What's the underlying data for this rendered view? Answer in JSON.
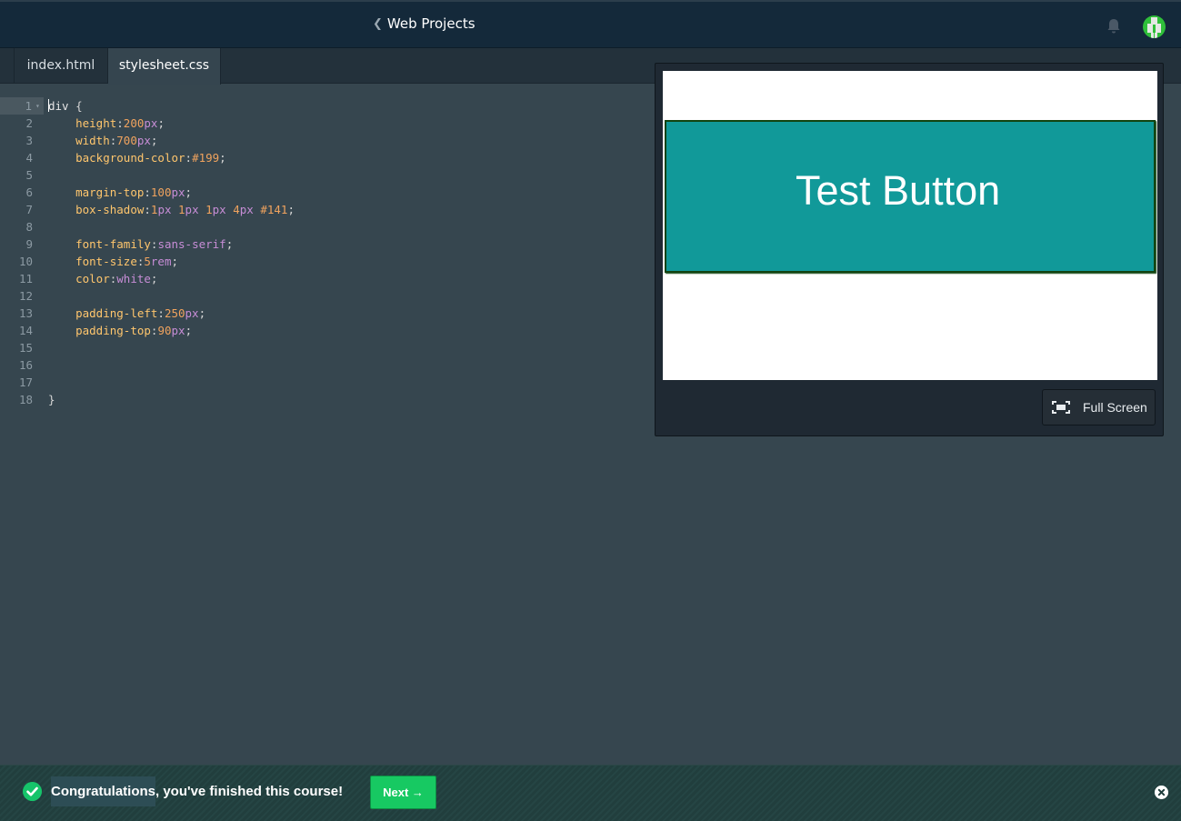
{
  "header": {
    "back_icon": "chevron-left-icon",
    "title": "Web Projects",
    "bell_icon": "bell-icon",
    "avatar_icon": "user-avatar-icon"
  },
  "tabs": [
    {
      "label": "index.html",
      "active": false
    },
    {
      "label": "stylesheet.css",
      "active": true
    }
  ],
  "editor": {
    "lines": [
      {
        "n": "1",
        "parts": [
          [
            "sel",
            "div"
          ],
          [
            "punc",
            " {"
          ]
        ]
      },
      {
        "n": "2",
        "parts": [
          [
            "punc",
            "    "
          ],
          [
            "prop",
            "height"
          ],
          [
            "punc",
            ":"
          ],
          [
            "num",
            "200"
          ],
          [
            "unit",
            "px"
          ],
          [
            "punc",
            ";"
          ]
        ]
      },
      {
        "n": "3",
        "parts": [
          [
            "punc",
            "    "
          ],
          [
            "prop",
            "width"
          ],
          [
            "punc",
            ":"
          ],
          [
            "num",
            "700"
          ],
          [
            "unit",
            "px"
          ],
          [
            "punc",
            ";"
          ]
        ]
      },
      {
        "n": "4",
        "parts": [
          [
            "punc",
            "    "
          ],
          [
            "prop",
            "background-color"
          ],
          [
            "punc",
            ":"
          ],
          [
            "num",
            "#199"
          ],
          [
            "punc",
            ";"
          ]
        ]
      },
      {
        "n": "5",
        "parts": []
      },
      {
        "n": "6",
        "parts": [
          [
            "punc",
            "    "
          ],
          [
            "prop",
            "margin-top"
          ],
          [
            "punc",
            ":"
          ],
          [
            "num",
            "100"
          ],
          [
            "unit",
            "px"
          ],
          [
            "punc",
            ";"
          ]
        ]
      },
      {
        "n": "7",
        "parts": [
          [
            "punc",
            "    "
          ],
          [
            "prop",
            "box-shadow"
          ],
          [
            "punc",
            ":"
          ],
          [
            "num",
            "1"
          ],
          [
            "unit",
            "px "
          ],
          [
            "num",
            "1"
          ],
          [
            "unit",
            "px "
          ],
          [
            "num",
            "1"
          ],
          [
            "unit",
            "px "
          ],
          [
            "num",
            "4"
          ],
          [
            "unit",
            "px "
          ],
          [
            "num",
            "#141"
          ],
          [
            "punc",
            ";"
          ]
        ]
      },
      {
        "n": "8",
        "parts": []
      },
      {
        "n": "9",
        "parts": [
          [
            "punc",
            "    "
          ],
          [
            "prop",
            "font-family"
          ],
          [
            "punc",
            ":"
          ],
          [
            "kw",
            "sans-serif"
          ],
          [
            "punc",
            ";"
          ]
        ]
      },
      {
        "n": "10",
        "parts": [
          [
            "punc",
            "    "
          ],
          [
            "prop",
            "font-size"
          ],
          [
            "punc",
            ":"
          ],
          [
            "num",
            "5"
          ],
          [
            "unit",
            "rem"
          ],
          [
            "punc",
            ";"
          ]
        ]
      },
      {
        "n": "11",
        "parts": [
          [
            "punc",
            "    "
          ],
          [
            "prop",
            "color"
          ],
          [
            "punc",
            ":"
          ],
          [
            "kw",
            "white"
          ],
          [
            "punc",
            ";"
          ]
        ]
      },
      {
        "n": "12",
        "parts": []
      },
      {
        "n": "13",
        "parts": [
          [
            "punc",
            "    "
          ],
          [
            "prop",
            "padding-left"
          ],
          [
            "punc",
            ":"
          ],
          [
            "num",
            "250"
          ],
          [
            "unit",
            "px"
          ],
          [
            "punc",
            ";"
          ]
        ]
      },
      {
        "n": "14",
        "parts": [
          [
            "punc",
            "    "
          ],
          [
            "prop",
            "padding-top"
          ],
          [
            "punc",
            ":"
          ],
          [
            "num",
            "90"
          ],
          [
            "unit",
            "px"
          ],
          [
            "punc",
            ";"
          ]
        ]
      },
      {
        "n": "15",
        "parts": []
      },
      {
        "n": "16",
        "parts": []
      },
      {
        "n": "17",
        "parts": []
      },
      {
        "n": "18",
        "parts": [
          [
            "punc",
            "}"
          ]
        ]
      }
    ]
  },
  "preview": {
    "button_text": "Test Button",
    "fullscreen_label": "Full Screen",
    "fullscreen_icon": "fullscreen-icon"
  },
  "banner": {
    "check_icon": "check-circle-icon",
    "message_highlight": "Congratulations",
    "message_rest": ", you've finished this course!",
    "next_label": "Next →",
    "close_icon": "close-circle-icon"
  },
  "colors": {
    "accent": "#17c962",
    "preview_box": "#119999",
    "editor_bg": "#36464f",
    "header_bg": "#14293a"
  }
}
